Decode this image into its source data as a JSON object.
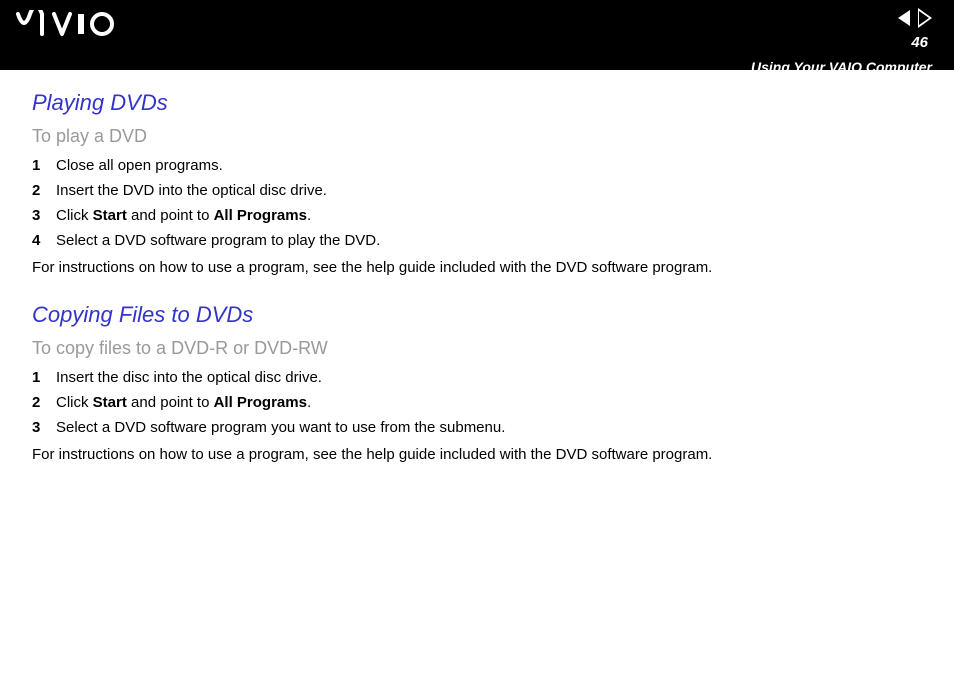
{
  "header": {
    "logo_text": "VAIO",
    "page_number": "46",
    "section_name": "Using Your VAIO Computer"
  },
  "section1": {
    "title": "Playing DVDs",
    "subtitle": "To play a DVD",
    "steps": {
      "s1_num": "1",
      "s1_text": "Close all open programs.",
      "s2_num": "2",
      "s2_text": "Insert the DVD into the optical disc drive.",
      "s3_num": "3",
      "s3_prefix": "Click ",
      "s3_bold1": "Start",
      "s3_mid": " and point to ",
      "s3_bold2": "All Programs",
      "s3_suffix": ".",
      "s4_num": "4",
      "s4_text": "Select a DVD software program to play the DVD."
    },
    "note": "For instructions on how to use a program, see the help guide included with the DVD software program."
  },
  "section2": {
    "title": "Copying Files to DVDs",
    "subtitle": "To copy files to a DVD-R or DVD-RW",
    "steps": {
      "s1_num": "1",
      "s1_text": "Insert the disc into the optical disc drive.",
      "s2_num": "2",
      "s2_prefix": "Click ",
      "s2_bold1": "Start",
      "s2_mid": " and point to ",
      "s2_bold2": "All Programs",
      "s2_suffix": ".",
      "s3_num": "3",
      "s3_text": "Select a DVD software program you want to use from the submenu."
    },
    "note": "For instructions on how to use a program, see the help guide included with the DVD software program."
  }
}
